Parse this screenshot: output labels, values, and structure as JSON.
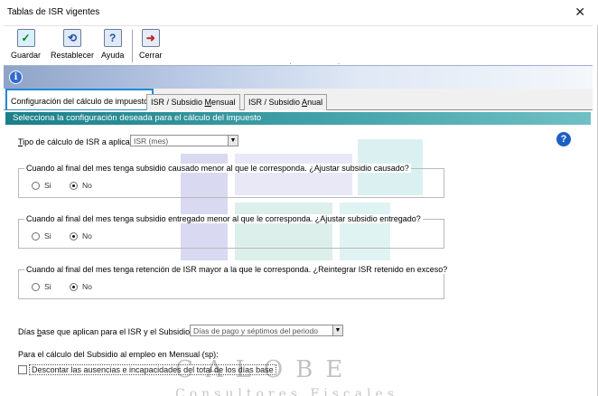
{
  "window": {
    "title": "Tablas de ISR vigentes",
    "close_glyph": "✕"
  },
  "toolbar": {
    "guardar": "Guardar",
    "restablecer": "Restablecer",
    "ayuda": "Ayuda",
    "cerrar": "Cerrar"
  },
  "tabs": [
    {
      "label": "Configuración del cálculo de impuesto"
    },
    {
      "label_pre": "ISR / Subsidio ",
      "label_u": "M",
      "label_post": "ensual"
    },
    {
      "label_pre": "ISR / Subsidio ",
      "label_u": "A",
      "label_post": "nual"
    }
  ],
  "section_header": "Selecciona la configuración deseada para el cálculo del impuesto",
  "tipo_calculo": {
    "label_u": "T",
    "label": "ipo de cálculo de ISR a aplicar:",
    "value": "ISR (mes)"
  },
  "groups": [
    {
      "legend": "Cuando al final del mes tenga subsidio causado menor al que le corresponda. ¿Ajustar subsidio causado?",
      "si": "Si",
      "no": "No",
      "selected": "No"
    },
    {
      "legend": "Cuando al final del mes tenga subsidio entregado menor al que le corresponda. ¿Ajustar subsidio entregado?",
      "si": "Si",
      "no": "No",
      "selected": "No"
    },
    {
      "legend": "Cuando al final del mes tenga retención de ISR mayor a la que le corresponda. ¿Reintegrar ISR retenido en exceso?",
      "si": "Si",
      "no": "No",
      "selected": "No"
    }
  ],
  "dias_base": {
    "label_pre": "Días ",
    "label_u": "b",
    "label_post": "ase que aplican para el  ISR y el Subsidio:",
    "value": "Días de pago y séptimos del periodo"
  },
  "subsidio_empleo": {
    "label": "Para el cálculo del Subsidio al empleo en Mensual (sp):",
    "checkbox_label": "Descontar las ausencias e incapacidades del total de los días base",
    "checked": false
  },
  "watermark": {
    "line1": "CALOBE",
    "line2": "Consultores Fiscales"
  },
  "colors": {
    "tab_highlight": "#1f8ad6",
    "section_header": "#1a7f89",
    "info_icon": "#2f6bd0"
  }
}
